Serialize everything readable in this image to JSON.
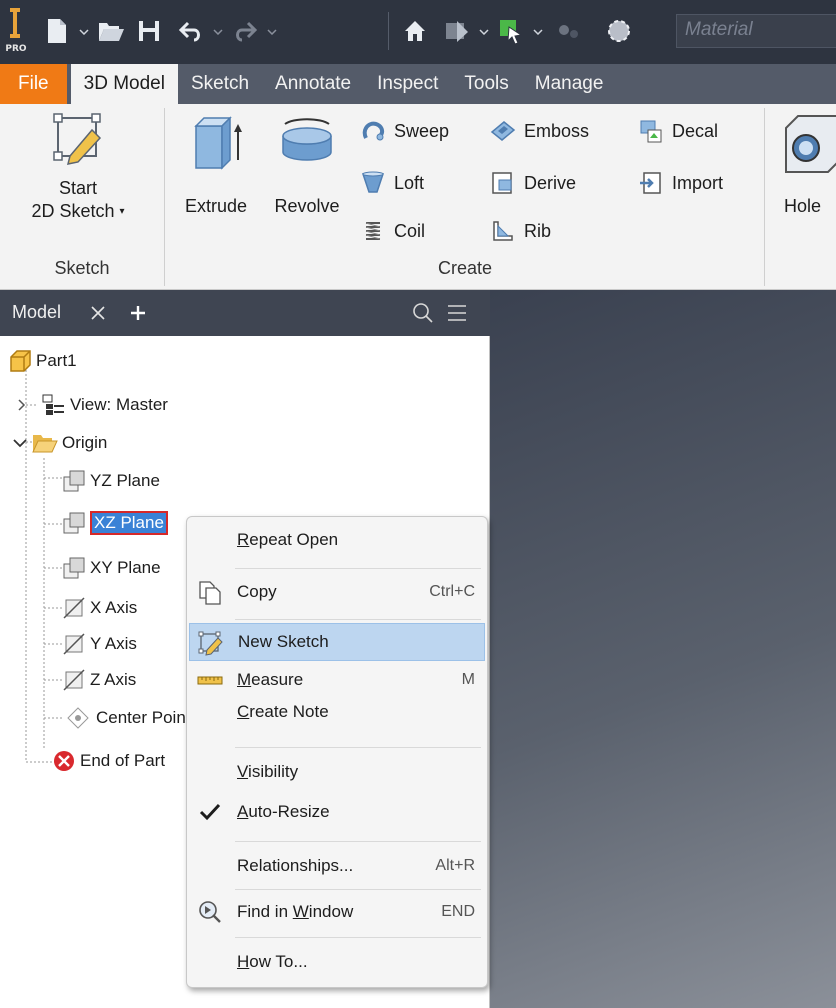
{
  "qat": {
    "logo_text": "PRO",
    "material_placeholder": "Material"
  },
  "tabs": [
    {
      "label": "File"
    },
    {
      "label": "3D Model"
    },
    {
      "label": "Sketch"
    },
    {
      "label": "Annotate"
    },
    {
      "label": "Inspect"
    },
    {
      "label": "Tools"
    },
    {
      "label": "Manage"
    }
  ],
  "ribbon": {
    "sketch_group": {
      "start_label_1": "Start",
      "start_label_2": "2D Sketch",
      "group_label": "Sketch"
    },
    "create_group": {
      "extrude": "Extrude",
      "revolve": "Revolve",
      "sweep": "Sweep",
      "emboss": "Emboss",
      "decal": "Decal",
      "loft": "Loft",
      "derive": "Derive",
      "import": "Import",
      "coil": "Coil",
      "rib": "Rib",
      "group_label": "Create"
    },
    "hole": "Hole"
  },
  "browser": {
    "title": "Model",
    "tree": {
      "part": "Part1",
      "view": "View: Master",
      "origin": "Origin",
      "yz": "YZ Plane",
      "xz": "XZ Plane",
      "xy": "XY Plane",
      "xaxis": "X Axis",
      "yaxis": "Y Axis",
      "zaxis": "Z Axis",
      "center": "Center Point",
      "end": "End of Part"
    }
  },
  "context_menu": {
    "repeat_open": "Repeat Open",
    "copy": "Copy",
    "copy_shortcut": "Ctrl+C",
    "new_sketch": "New Sketch",
    "measure": "Measure",
    "measure_shortcut": "M",
    "create_note": "Create Note",
    "visibility": "Visibility",
    "auto_resize": "Auto-Resize",
    "relationships": "Relationships...",
    "relationships_shortcut": "Alt+R",
    "find_in_window": "Find in Window",
    "find_shortcut": "END",
    "how_to": "How To..."
  }
}
